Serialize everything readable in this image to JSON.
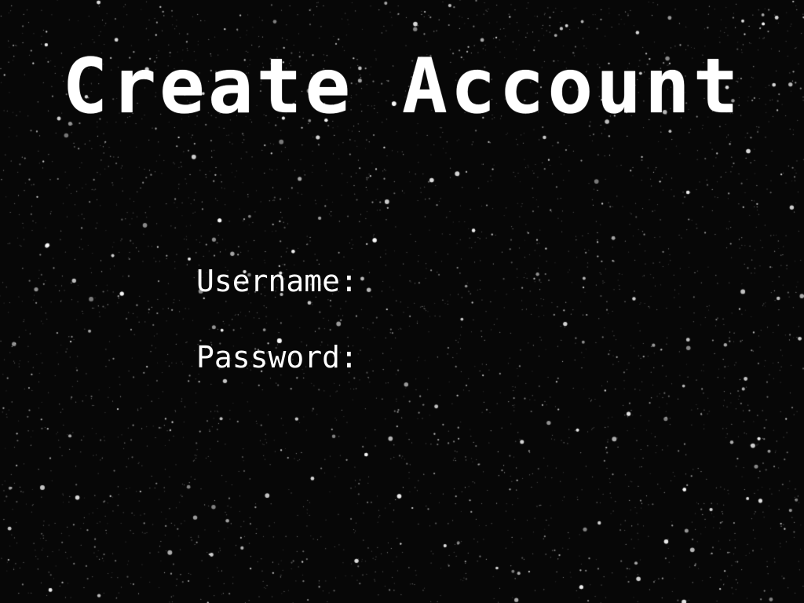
{
  "screen": {
    "title": "Create Account"
  },
  "form": {
    "username": {
      "label": "Username:",
      "value": ""
    },
    "password": {
      "label": "Password:",
      "value": ""
    }
  },
  "theme": {
    "background": "#070707",
    "text": "#ffffff",
    "stars": "#ffffff"
  }
}
